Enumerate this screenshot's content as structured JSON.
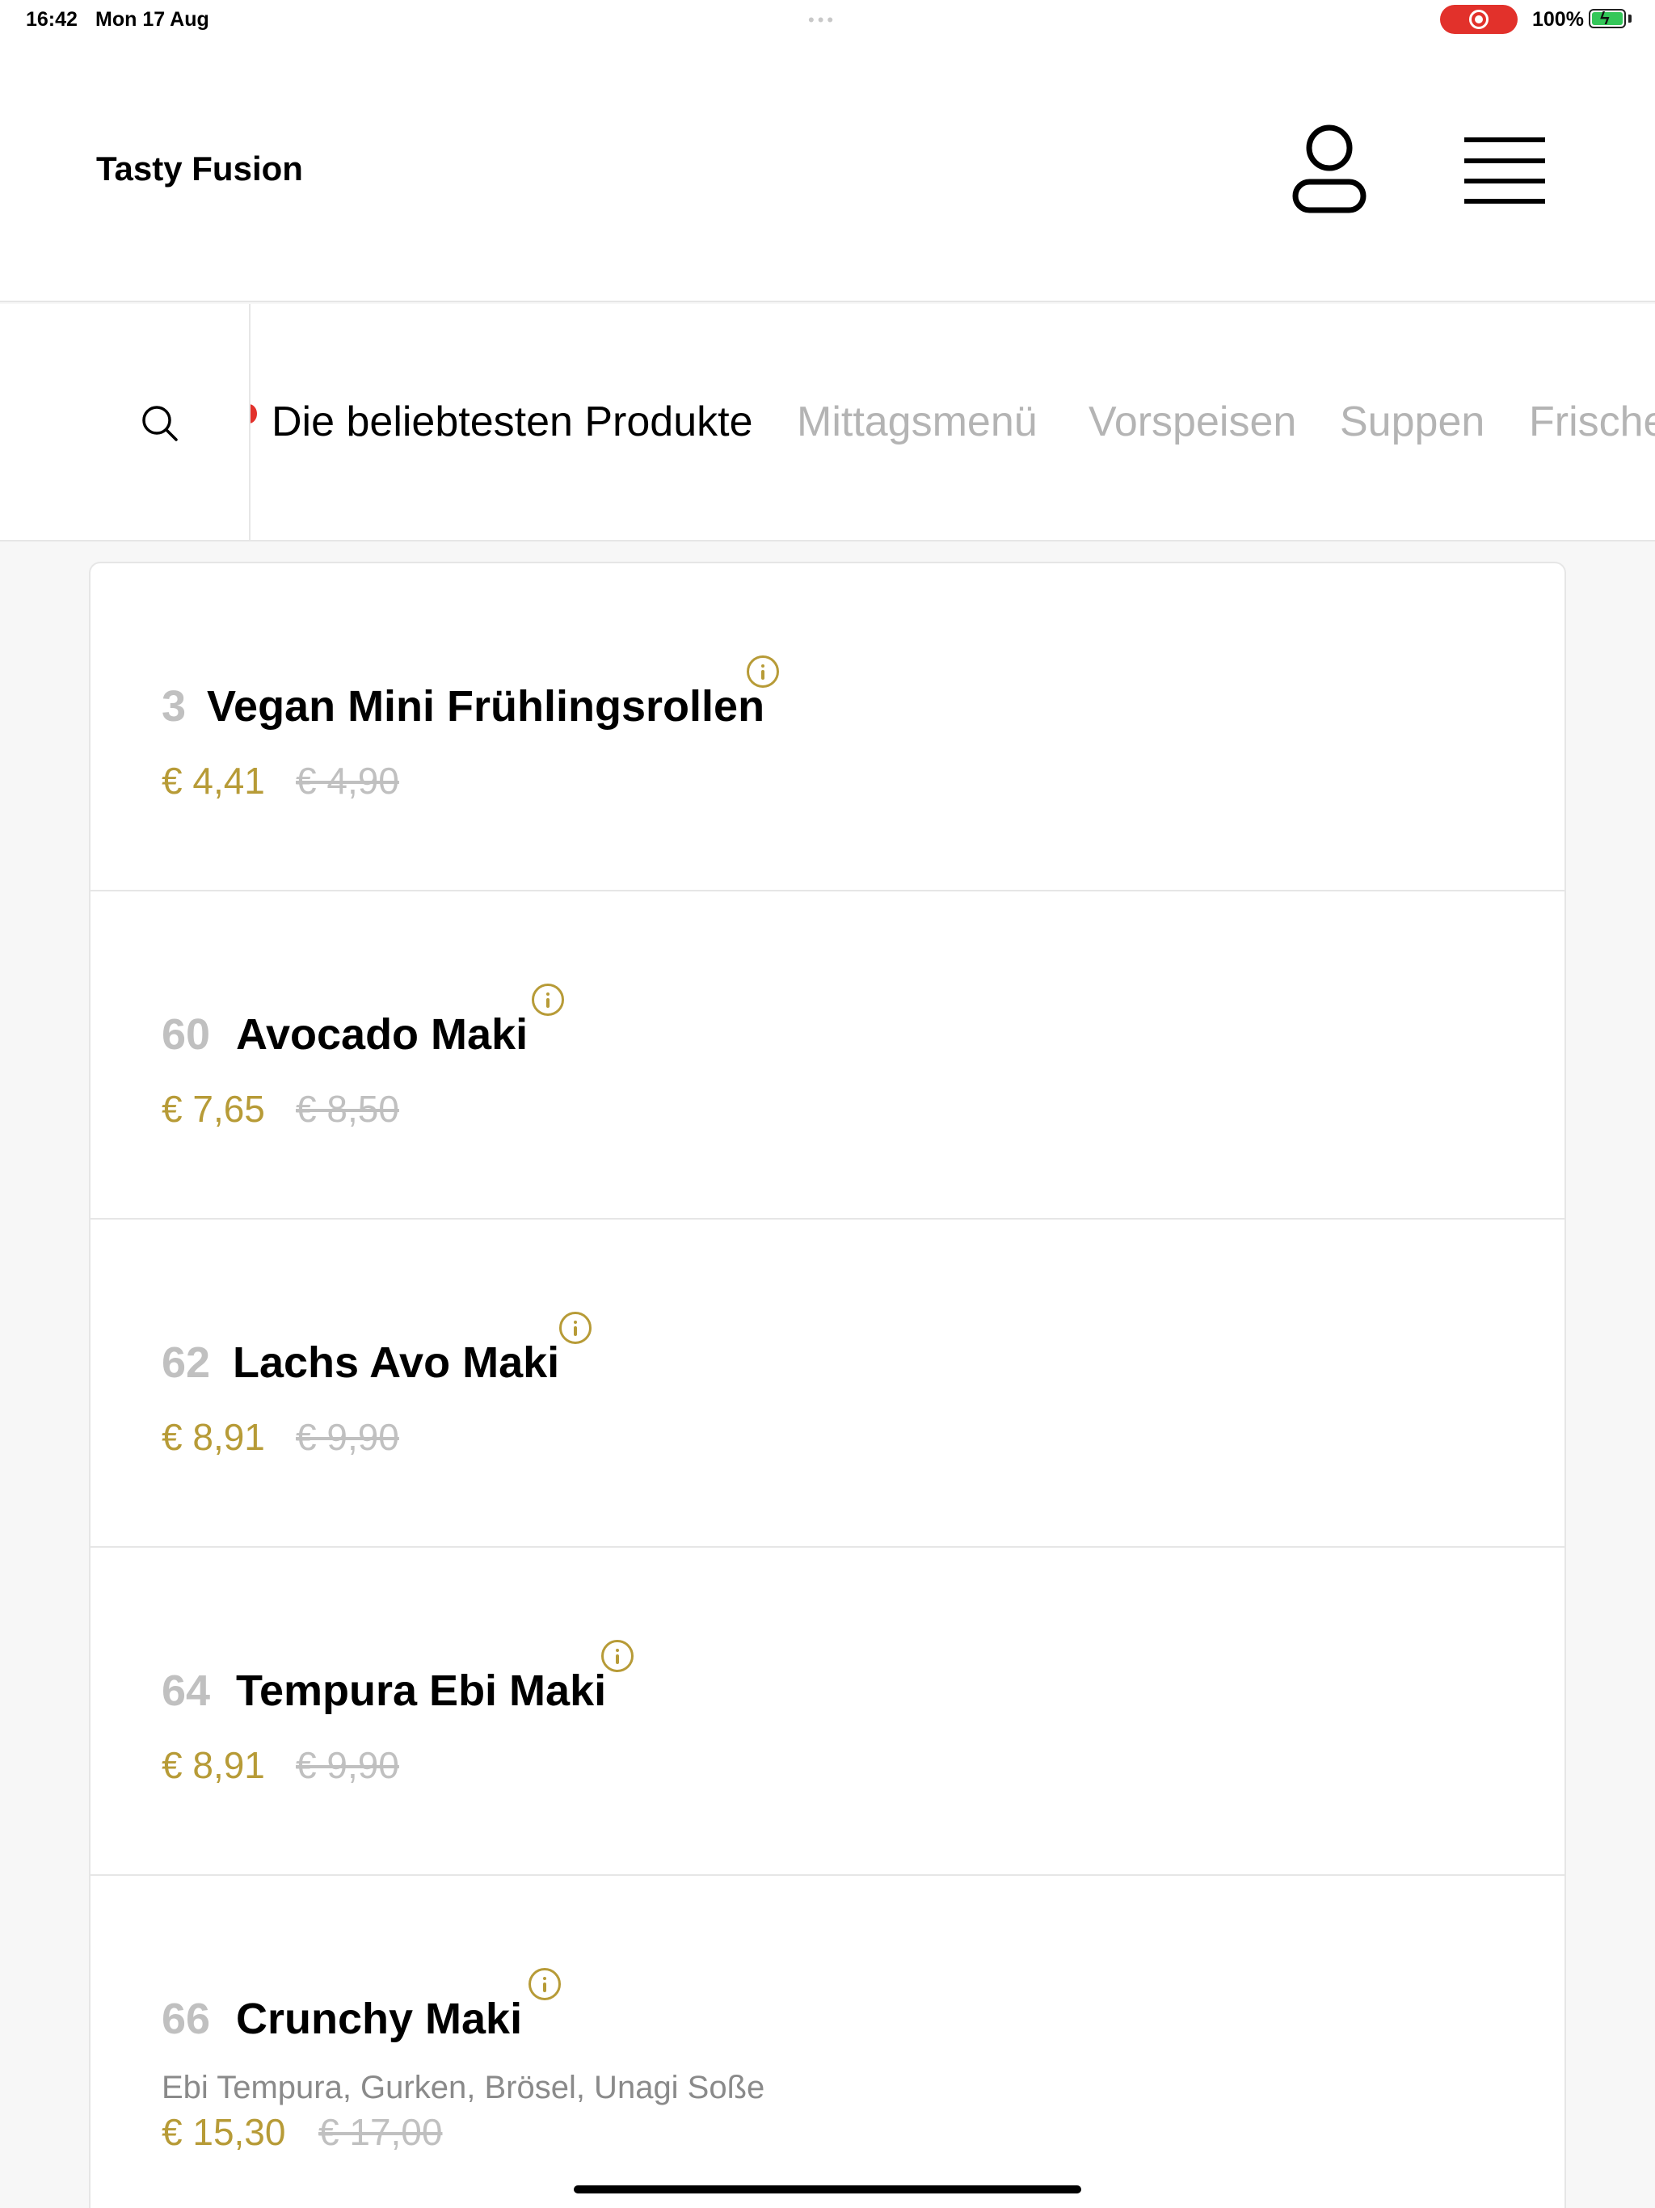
{
  "status_bar": {
    "time": "16:42",
    "date": "Mon 17 Aug",
    "battery": "100%",
    "recording_color": "#e2312b",
    "battery_color": "#34c759"
  },
  "header": {
    "brand": "Tasty Fusion",
    "user_icon": "user-icon",
    "menu_icon": "hamburger-menu-icon"
  },
  "categories": {
    "search_icon": "search-icon",
    "active_indicator_color": "#e2312b",
    "tabs": [
      {
        "label": "Die beliebtesten Produkte",
        "active": true
      },
      {
        "label": "Mittagsmenü",
        "active": false
      },
      {
        "label": "Vorspeisen",
        "active": false
      },
      {
        "label": "Suppen",
        "active": false
      },
      {
        "label": "Frische",
        "active": false
      }
    ]
  },
  "theme": {
    "accent_gold": "#b79b37",
    "muted_gray": "#c0c0c0"
  },
  "products": [
    {
      "number": "3",
      "name": "Vegan Mini Frühlingsrollen",
      "price": "€ 4,41",
      "old_price": "€ 4,90",
      "description": ""
    },
    {
      "number": "60",
      "name": "Avocado Maki",
      "price": "€ 7,65",
      "old_price": "€ 8,50",
      "description": ""
    },
    {
      "number": "62",
      "name": "Lachs Avo Maki",
      "price": "€ 8,91",
      "old_price": "€ 9,90",
      "description": ""
    },
    {
      "number": "64",
      "name": "Tempura Ebi Maki",
      "price": "€ 8,91",
      "old_price": "€ 9,90",
      "description": ""
    },
    {
      "number": "66",
      "name": "Crunchy Maki",
      "price": "€ 15,30",
      "old_price": "€ 17,00",
      "description": "Ebi Tempura, Gurken, Brösel, Unagi Soße"
    }
  ]
}
